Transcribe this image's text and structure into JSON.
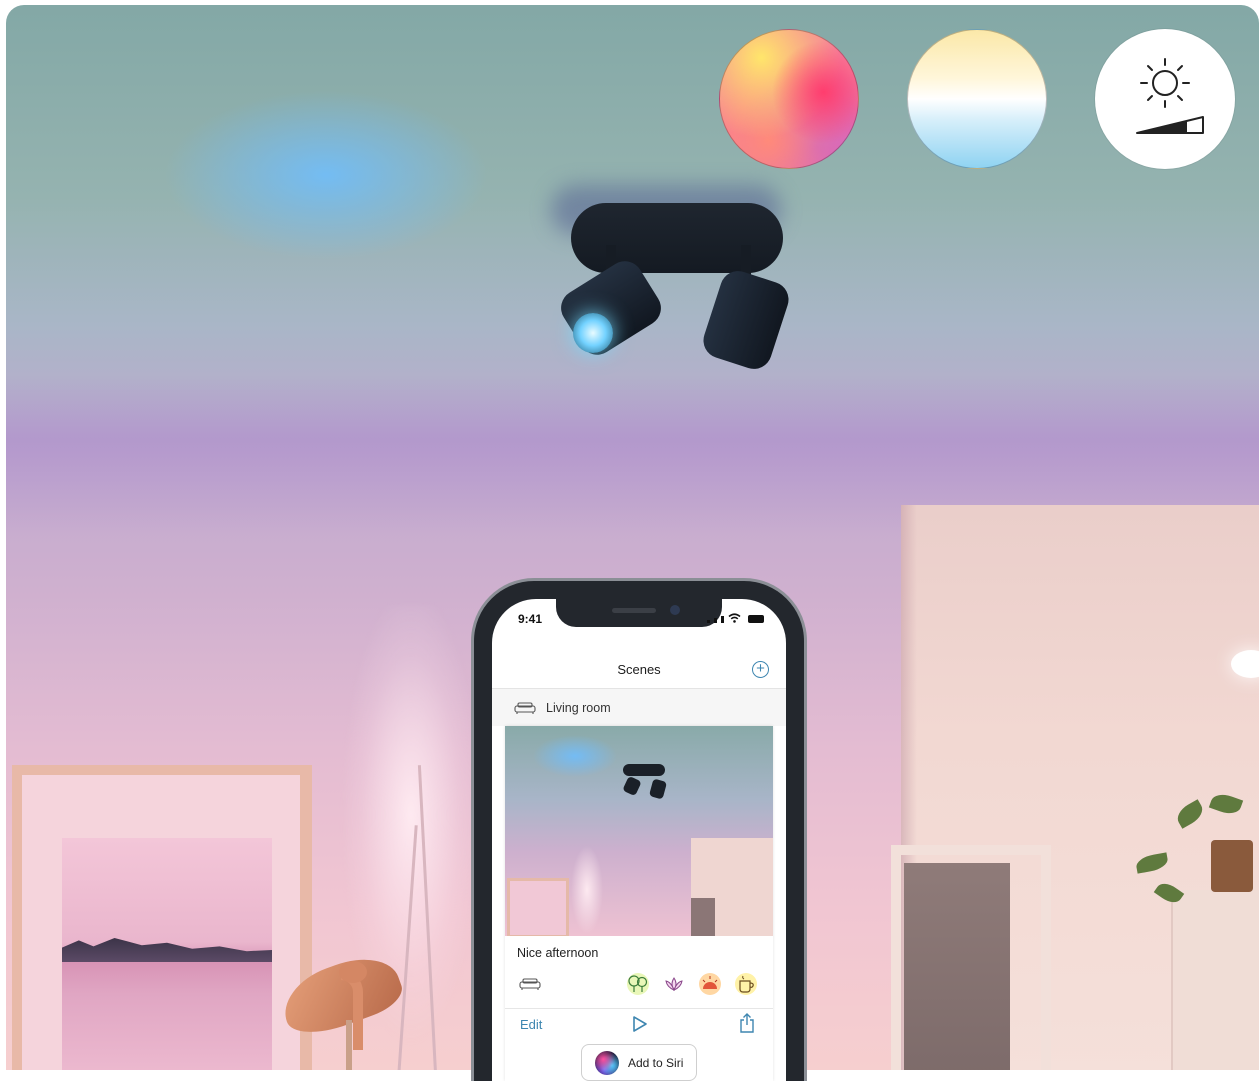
{
  "phone": {
    "status_time": "9:41",
    "nav_title": "Scenes",
    "room_label": "Living room",
    "scene_name": "Nice afternoon",
    "edit_label": "Edit",
    "siri_label": "Add to Siri",
    "accent_color": "#3e86b0"
  },
  "feature_chips": [
    {
      "icon": "color-palette-chip"
    },
    {
      "icon": "white-tunable-chip"
    },
    {
      "icon": "brightness-dimming-chip"
    }
  ],
  "mood_icons": [
    "trees-icon",
    "lotus-icon",
    "sunset-icon",
    "coffee-cup-icon"
  ]
}
